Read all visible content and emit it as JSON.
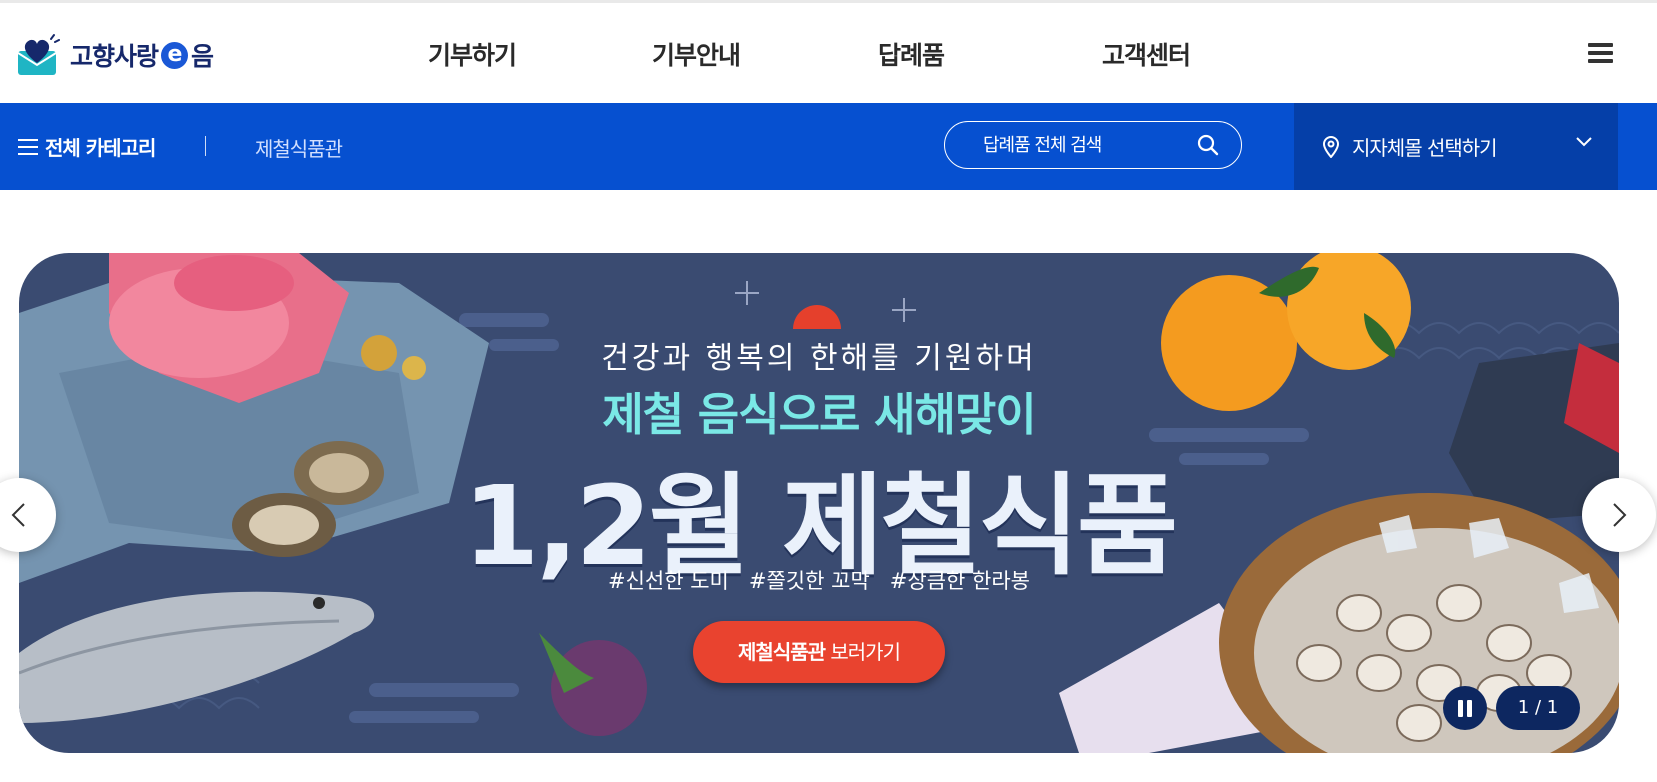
{
  "header": {
    "logo_text_left": "고향사랑",
    "logo_text_e": "e",
    "logo_text_right": "음",
    "nav": [
      "기부하기",
      "기부안내",
      "답례품",
      "고객센터"
    ],
    "menu_icon": "hamburger-menu-icon"
  },
  "subbar": {
    "all_categories": "전체 카테고리",
    "breadcrumb": "제철식품관",
    "search_placeholder": "답례품 전체 검색",
    "region_select": "지자체몰 선택하기",
    "colors": {
      "bar": "#0650d0",
      "region": "#053fa8"
    }
  },
  "banner": {
    "line1": "건강과 행복의 한해를 기원하며",
    "line2": "제철 음식으로 새해맞이",
    "line3": "1,2월 제철식품",
    "hashtags": "#신선한 도미   #쫄깃한 꼬막   #상큼한 한라봉",
    "cta_bold": "제철식품관",
    "cta_rest": " 보러가기",
    "counter": "1 / 1",
    "colors": {
      "background": "#3a4b71",
      "cta": "#e9432f",
      "highlight": "#7ae8e6"
    }
  }
}
